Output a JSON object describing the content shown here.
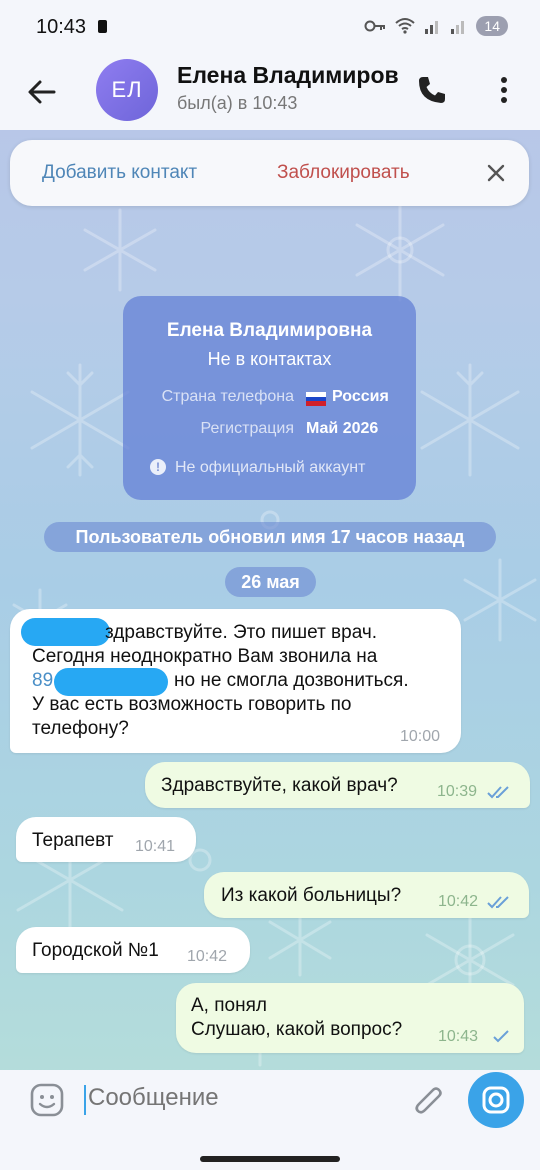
{
  "status_bar": {
    "time": "10:43",
    "battery": "14"
  },
  "header": {
    "avatar_initials": "ЕЛ",
    "contact_name": "Елена Владимировна",
    "last_seen": "был(а) в 10:43",
    "icons": [
      "back-arrow-icon",
      "phone-icon",
      "more-vertical-icon"
    ]
  },
  "action_bar": {
    "add_contact": "Добавить контакт",
    "block": "Заблокировать"
  },
  "info_card": {
    "name": "Елена Владимировна",
    "subtitle": "Не в контактах",
    "country_label": "Страна телефона",
    "country_value": "Россия",
    "registration_label": "Регистрация",
    "registration_value": "Май 2026",
    "warning": "Не официальный аккаунт"
  },
  "service_messages": {
    "name_changed": "Пользователь обновил имя 17 часов назад",
    "date": "26 мая"
  },
  "messages": [
    {
      "direction": "incoming",
      "lines": [
        "здравствуйте. Это пишет врач.",
        "Сегодня неоднократно Вам звонила на",
        "89",
        "но не смогла дозвониться.",
        "У вас есть возможность говорить по",
        "телефону?"
      ],
      "time": "10:00"
    },
    {
      "direction": "outgoing",
      "text": "Здравствуйте, какой врач?",
      "time": "10:39",
      "status": "read"
    },
    {
      "direction": "incoming",
      "text": "Терапевт",
      "time": "10:41"
    },
    {
      "direction": "outgoing",
      "text": "Из какой больницы?",
      "time": "10:42",
      "status": "read"
    },
    {
      "direction": "incoming",
      "text": "Городской №1",
      "time": "10:42"
    },
    {
      "direction": "outgoing",
      "lines": [
        "А, понял",
        "Слушаю, какой вопрос?"
      ],
      "time": "10:43",
      "status": "sent"
    }
  ],
  "composer": {
    "placeholder": "Сообщение",
    "icons": [
      "emoji-icon",
      "attach-icon",
      "camera-icon"
    ]
  },
  "colors": {
    "accent": "#3aa3e8",
    "block_red": "#c0504d",
    "add_blue": "#4f86b7",
    "outgoing_bubble": "#effbe3",
    "redaction_blue": "#27a8f3"
  }
}
